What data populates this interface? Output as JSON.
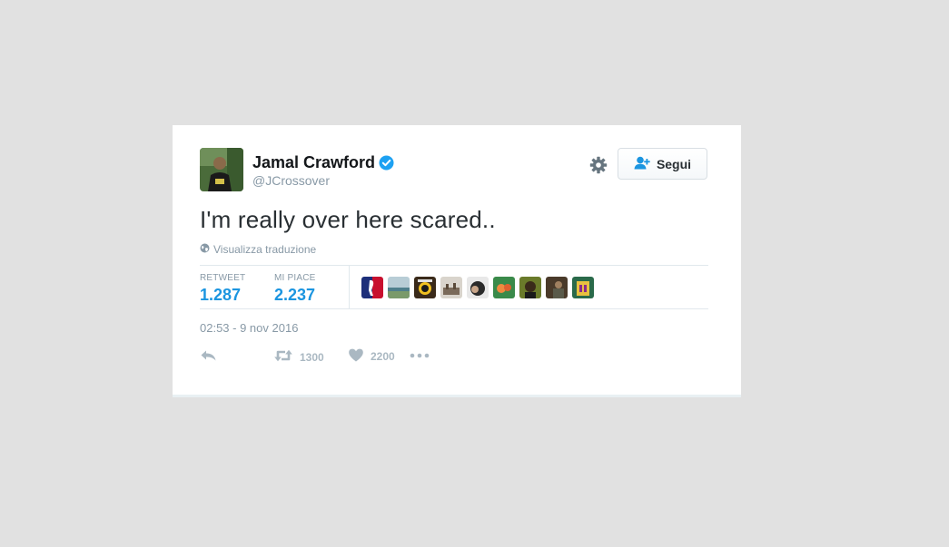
{
  "tweet": {
    "author_name": "Jamal Crawford",
    "author_handle": "@JCrossover",
    "text": "I'm really over here scared..",
    "translate_label": "Visualizza traduzione",
    "timestamp": "02:53 - 9 nov 2016"
  },
  "header": {
    "follow_label": "Segui",
    "verified": true
  },
  "stats": {
    "retweet_label": "RETWEET",
    "retweet_value": "1.287",
    "likes_label": "MI PIACE",
    "likes_value": "2.237",
    "liker_avatars": [
      "avatar-1",
      "avatar-2",
      "avatar-3",
      "avatar-4",
      "avatar-5",
      "avatar-6",
      "avatar-7",
      "avatar-8",
      "avatar-9"
    ]
  },
  "actions": {
    "reply_icon": "reply-icon",
    "retweet_count": "1300",
    "like_count": "2200",
    "more_icon": "more-icon"
  },
  "colors": {
    "accent": "#1b95e0",
    "verified": "#1da1f2",
    "muted": "#8899a6",
    "action_gray": "#aab8c2",
    "background": "#e1e1e1"
  }
}
